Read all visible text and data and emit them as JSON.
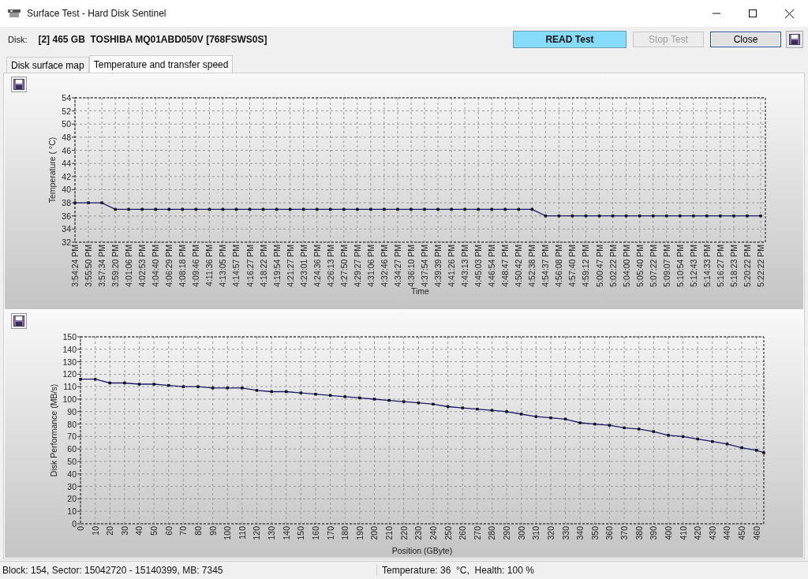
{
  "window": {
    "title": "Surface Test - Hard Disk Sentinel"
  },
  "toolbar": {
    "disk_label": "Disk:",
    "disk": "[2] 465 GB  TOSHIBA MQ01ABD050V [768FSWS0S]",
    "buttons": [
      {
        "label": "READ Test",
        "kind": "indicator",
        "disabled": false
      },
      {
        "label": "Stop Test",
        "kind": "button",
        "disabled": true
      },
      {
        "label": "Close",
        "kind": "button",
        "disabled": false
      }
    ]
  },
  "tabs": [
    {
      "label": "Disk surface map",
      "selected": false
    },
    {
      "label": "Temperature and transfer speed",
      "selected": true
    }
  ],
  "temperature_panel": {
    "chart_data": {
      "type": "line",
      "xlabel": "Time",
      "ylabel": "Temperature ( °C)",
      "categories": [
        "3:54:24 PM",
        "3:55:50 PM",
        "3:57:34 PM",
        "3:59:20 PM",
        "4:01:06 PM",
        "4:02:53 PM",
        "4:04:40 PM",
        "4:06:29 PM",
        "4:08:18 PM",
        "4:09:46 PM",
        "4:11:36 PM",
        "4:13:05 PM",
        "4:14:57 PM",
        "4:16:27 PM",
        "4:18:22 PM",
        "4:19:54 PM",
        "4:21:27 PM",
        "4:23:01 PM",
        "4:24:36 PM",
        "4:26:13 PM",
        "4:27:50 PM",
        "4:29:27 PM",
        "4:31:06 PM",
        "4:32:46 PM",
        "4:34:27 PM",
        "4:36:10 PM",
        "4:37:54 PM",
        "4:39:39 PM",
        "4:41:26 PM",
        "4:43:13 PM",
        "4:45:03 PM",
        "4:46:54 PM",
        "4:48:47 PM",
        "4:50:42 PM",
        "4:52:38 PM",
        "4:54:37 PM",
        "4:56:08 PM",
        "4:57:40 PM",
        "4:59:12 PM",
        "5:00:47 PM",
        "5:02:22 PM",
        "5:04:00 PM",
        "5:05:40 PM",
        "5:07:22 PM",
        "5:09:07 PM",
        "5:10:54 PM",
        "5:12:43 PM",
        "5:14:33 PM",
        "5:16:27 PM",
        "5:18:23 PM",
        "5:20:22 PM",
        "5:22:22 PM"
      ],
      "grid": true,
      "series": [
        {
          "color": "#1a1a6e",
          "marker": "square",
          "values": [
            38,
            38,
            38,
            37,
            37,
            37,
            37,
            37,
            37,
            37,
            37,
            37,
            37,
            37,
            37,
            37,
            37,
            37,
            37,
            37,
            37,
            37,
            37,
            37,
            37,
            37,
            37,
            37,
            37,
            37,
            37,
            37,
            37,
            37,
            37,
            36,
            36,
            36,
            36,
            36,
            36,
            36,
            36,
            36,
            36,
            36,
            36,
            36,
            36,
            36,
            36,
            36
          ]
        }
      ],
      "ylim": [
        32,
        54
      ],
      "yticks": [
        32,
        34,
        36,
        38,
        40,
        42,
        44,
        46,
        48,
        50,
        52,
        54
      ]
    }
  },
  "performance_panel": {
    "chart_data": {
      "type": "line",
      "xlabel": "Position (GByte)",
      "ylabel": "Disk Performance (MB/s)",
      "x": [
        0,
        10,
        20,
        30,
        40,
        50,
        60,
        70,
        80,
        90,
        100,
        110,
        120,
        130,
        140,
        150,
        160,
        170,
        180,
        190,
        200,
        210,
        220,
        230,
        240,
        250,
        260,
        270,
        280,
        290,
        300,
        310,
        320,
        330,
        340,
        350,
        360,
        370,
        380,
        390,
        400,
        410,
        420,
        430,
        440,
        450,
        460,
        465
      ],
      "grid": true,
      "series": [
        {
          "color": "#1a1a6e",
          "marker": "square",
          "values": [
            116,
            116,
            113,
            113,
            112,
            112,
            111,
            110,
            110,
            109,
            109,
            109,
            107,
            106,
            106,
            105,
            104,
            103,
            102,
            101,
            100,
            99,
            98,
            97,
            96,
            94,
            93,
            92,
            91,
            90,
            88,
            86,
            85,
            84,
            81,
            80,
            79,
            77,
            76,
            74,
            71,
            70,
            68,
            66,
            64,
            61,
            59,
            57
          ]
        }
      ],
      "xlim": [
        0,
        465
      ],
      "ylim": [
        0,
        150
      ],
      "xticks": [
        0,
        10,
        20,
        30,
        40,
        50,
        60,
        70,
        80,
        90,
        100,
        110,
        120,
        130,
        140,
        150,
        160,
        170,
        180,
        190,
        200,
        210,
        220,
        230,
        240,
        250,
        260,
        270,
        280,
        290,
        300,
        310,
        320,
        330,
        340,
        350,
        360,
        370,
        380,
        390,
        400,
        410,
        420,
        430,
        440,
        450,
        460
      ],
      "yticks": [
        0,
        10,
        20,
        30,
        40,
        50,
        60,
        70,
        80,
        90,
        100,
        110,
        120,
        130,
        140,
        150
      ]
    }
  },
  "status_bar": [
    "Block: 154, Sector: 15042720 - 15140399, MB: 7345",
    "Temperature: 36  °C,  Health: 100 %"
  ]
}
